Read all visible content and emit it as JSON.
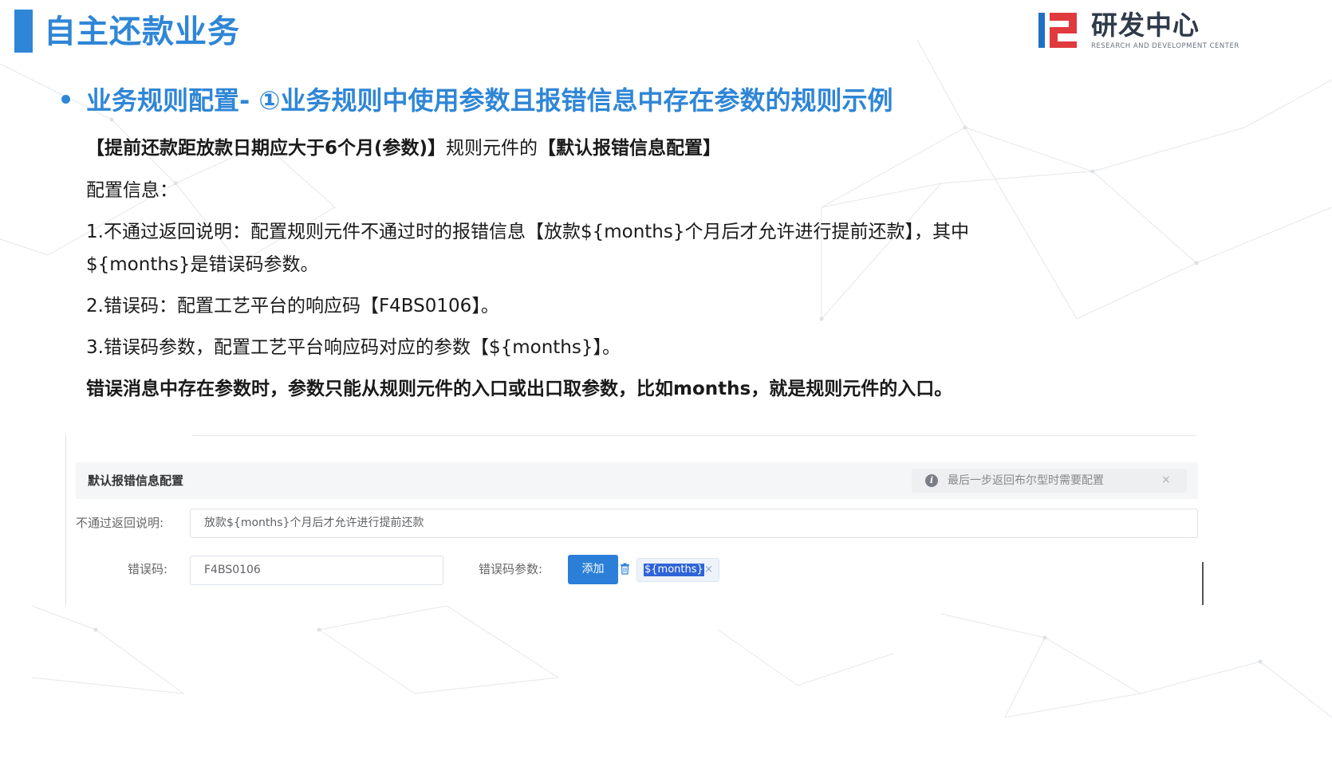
{
  "header": {
    "title": "自主还款业务",
    "logo_cn": "研发中心",
    "logo_en": "RESEARCH AND DEVELOPMENT CENTER"
  },
  "section": {
    "title": "业务规则配置- ①业务规则中使用参数且报错信息中存在参数的规则示例"
  },
  "body": {
    "line1_bold_a": "【提前还款距放款日期应大于6个月(参数)】",
    "line1_normal": "规则元件的",
    "line1_bold_b": "【默认报错信息配置】",
    "line2": "配置信息：",
    "line3": "1.不通过返回说明：配置规则元件不通过时的报错信息【放款${months}个月后才允许进行提前还款】，其中",
    "line3b": "${months}是错误码参数。",
    "line4": "2.错误码：配置工艺平台的响应码【F4BS0106】。",
    "line5": "3.错误码参数，配置工艺平台响应码对应的参数【${months}】。",
    "line6": "错误消息中存在参数时，参数只能从规则元件的入口或出口取参数，比如months，就是规则元件的入口。"
  },
  "form": {
    "title": "默认报错信息配置",
    "tip": "最后一步返回布尔型时需要配置",
    "tip_close": "×",
    "reason_label": "不通过返回说明:",
    "reason_value": "放款${months}个月后才允许进行提前还款",
    "code_label": "错误码:",
    "code_value": "F4BS0106",
    "param_label": "错误码参数:",
    "add_button": "添加",
    "tag_value": "${months}",
    "tag_close": "×"
  },
  "colors": {
    "accent": "#2f86d6",
    "button": "#2b7fd8",
    "logo_red": "#e0393e",
    "logo_blue": "#1f6fc4"
  },
  "icons": {
    "tip": "info-icon",
    "delete": "trash-icon",
    "tag_close": "close-icon"
  }
}
